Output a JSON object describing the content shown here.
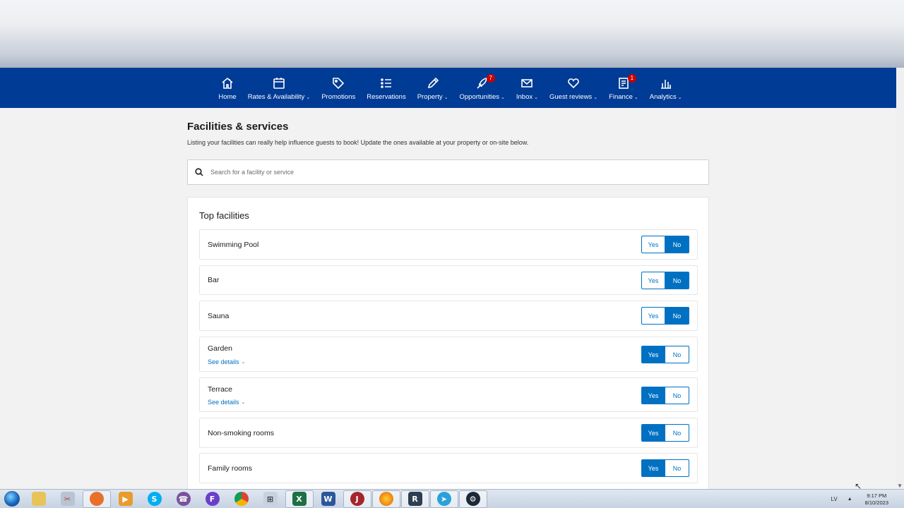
{
  "nav": {
    "items": [
      {
        "label": "Home",
        "icon": "home-icon",
        "dropdown": false
      },
      {
        "label": "Rates & Availability",
        "icon": "calendar-icon",
        "dropdown": true
      },
      {
        "label": "Promotions",
        "icon": "tag-icon",
        "dropdown": false
      },
      {
        "label": "Reservations",
        "icon": "list-icon",
        "dropdown": false
      },
      {
        "label": "Property",
        "icon": "pencil-icon",
        "dropdown": true
      },
      {
        "label": "Opportunities",
        "icon": "rocket-icon",
        "dropdown": true,
        "badge": "7"
      },
      {
        "label": "Inbox",
        "icon": "envelope-icon",
        "dropdown": true
      },
      {
        "label": "Guest reviews",
        "icon": "heart-icon",
        "dropdown": true
      },
      {
        "label": "Finance",
        "icon": "invoice-icon",
        "dropdown": true,
        "badge": "1"
      },
      {
        "label": "Analytics",
        "icon": "bar-chart-icon",
        "dropdown": true
      }
    ],
    "background": "#003b95"
  },
  "page": {
    "title": "Facilities & services",
    "description": "Listing your facilities can really help influence guests to book! Update the ones available at your property or on-site below.",
    "search_placeholder": "Search for a facility or service"
  },
  "top_facilities": {
    "title": "Top facilities",
    "yes_label": "Yes",
    "no_label": "No",
    "see_details_label": "See details",
    "items": [
      {
        "name": "Swimming Pool",
        "value": "No",
        "details": false
      },
      {
        "name": "Bar",
        "value": "No",
        "details": false
      },
      {
        "name": "Sauna",
        "value": "No",
        "details": false
      },
      {
        "name": "Garden",
        "value": "Yes",
        "details": true
      },
      {
        "name": "Terrace",
        "value": "Yes",
        "details": true
      },
      {
        "name": "Non-smoking rooms",
        "value": "Yes",
        "details": false
      },
      {
        "name": "Family rooms",
        "value": "Yes",
        "details": false
      }
    ]
  },
  "accent": "#0071c2",
  "taskbar": {
    "apps": [
      "windows-explorer",
      "snipping-tool",
      "browser-orange",
      "media-player",
      "skype",
      "viber",
      "fiverr",
      "chrome",
      "calculator",
      "excel",
      "word",
      "winrar-app",
      "firefox",
      "remote-app",
      "telegram",
      "steam"
    ],
    "language": "LV",
    "time": "9:17 PM",
    "date": "8/10/2023"
  }
}
